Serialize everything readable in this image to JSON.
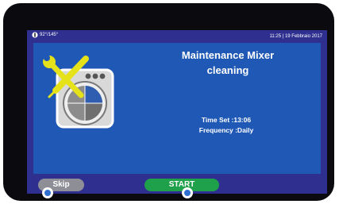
{
  "status": {
    "left_text": "92°/145°",
    "time": "11:25",
    "separator": "|",
    "date": "19 Febbraio 2017"
  },
  "main": {
    "title_line1": "Maintenance Mixer",
    "title_line2": "cleaning",
    "time_set": "Time Set :13:06",
    "frequency": "Frequency :Daily",
    "icon": "mixer-maintenance-icon"
  },
  "buttons": {
    "skip_label": "Skip",
    "start_label": "START"
  },
  "colors": {
    "screen_bg": "#2e2f8f",
    "panel_bg": "#1f58b5",
    "skip_bg": "#8e8e97",
    "start_bg": "#1fa04a",
    "tool_yellow": "#e6e21a"
  }
}
